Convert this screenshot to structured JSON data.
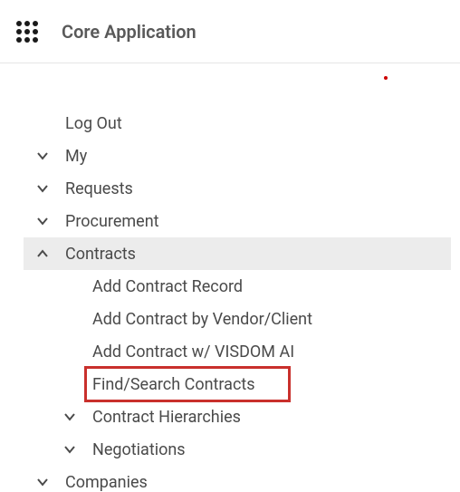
{
  "header": {
    "title": "Core Application"
  },
  "nav": {
    "logout": "Log Out",
    "items": [
      {
        "label": "My",
        "expanded": false
      },
      {
        "label": "Requests",
        "expanded": false
      },
      {
        "label": "Procurement",
        "expanded": false
      },
      {
        "label": "Contracts",
        "expanded": true,
        "children": [
          {
            "label": "Add Contract Record"
          },
          {
            "label": "Add Contract by Vendor/Client"
          },
          {
            "label": "Add Contract w/ VISDOM AI"
          },
          {
            "label": "Find/Search Contracts",
            "highlighted": true
          },
          {
            "label": "Contract Hierarchies",
            "expandable": true,
            "expanded": false
          },
          {
            "label": "Negotiations",
            "expandable": true,
            "expanded": false
          }
        ]
      },
      {
        "label": "Companies",
        "expanded": false
      }
    ]
  },
  "colors": {
    "highlight": "#c9302c"
  }
}
